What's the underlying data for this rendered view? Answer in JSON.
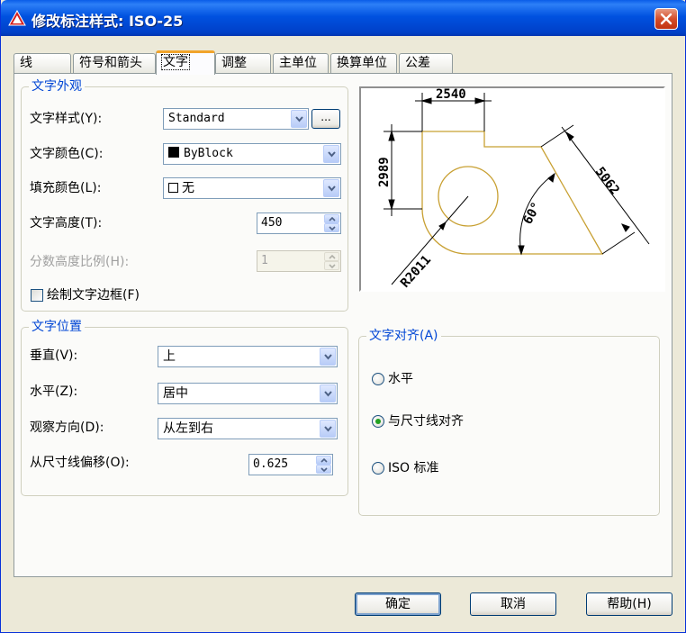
{
  "window": {
    "title": "修改标注样式: ISO-25",
    "close_label": "×"
  },
  "tabs": [
    {
      "label": "线"
    },
    {
      "label": "符号和箭头"
    },
    {
      "label": "文字"
    },
    {
      "label": "调整"
    },
    {
      "label": "主单位"
    },
    {
      "label": "换算单位"
    },
    {
      "label": "公差"
    }
  ],
  "text_appearance": {
    "title": "文字外观",
    "style_label": "文字样式(Y):",
    "style_value": "Standard",
    "browse_label": "...",
    "color_label": "文字颜色(C):",
    "color_value": "ByBlock",
    "color_swatch": "#000000",
    "fill_label": "填充颜色(L):",
    "fill_value": "无",
    "height_label": "文字高度(T):",
    "height_value": "450",
    "fraction_label": "分数高度比例(H):",
    "fraction_value": "1",
    "frame_label": "绘制文字边框(F)",
    "frame_checked": false
  },
  "text_placement": {
    "title": "文字位置",
    "vertical_label": "垂直(V):",
    "vertical_value": "上",
    "horizontal_label": "水平(Z):",
    "horizontal_value": "居中",
    "view_dir_label": "观察方向(D):",
    "view_dir_value": "从左到右",
    "offset_label": "从尺寸线偏移(O):",
    "offset_value": "0.625"
  },
  "text_alignment": {
    "title": "文字对齐(A)",
    "options": [
      {
        "label": "水平",
        "selected": false
      },
      {
        "label": "与尺寸线对齐",
        "selected": true
      },
      {
        "label": "ISO 标准",
        "selected": false
      }
    ]
  },
  "preview": {
    "dim_top": "2540",
    "dim_left": "2989",
    "dim_right": "5062",
    "dim_angle": "60°",
    "dim_radius": "R2011"
  },
  "buttons": {
    "ok": "确定",
    "cancel": "取消",
    "help": "帮助(H)"
  },
  "colors": {
    "accent": "#0046d5",
    "drawing_outline": "#c8a032",
    "titlebar": "#0052e0"
  }
}
